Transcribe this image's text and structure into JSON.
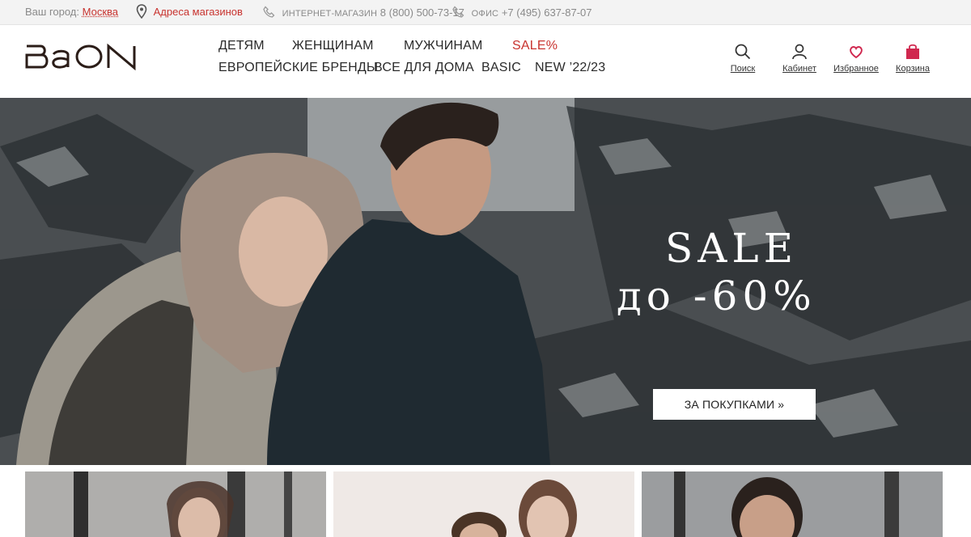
{
  "topbar": {
    "city_label": "Ваш город:",
    "city_value": "Москва",
    "stores_link": "Адреса магазинов",
    "online_label": "ИНТЕРНЕТ-МАГАЗИН",
    "online_phone": "8 (800) 500-73-17",
    "office_label": "ОФИС",
    "office_phone": "+7 (495) 637-87-07"
  },
  "header": {
    "logo_text": "BAON",
    "nav": {
      "kids": "ДЕТЯМ",
      "women": "ЖЕНЩИНАМ",
      "men": "МУЖЧИНАМ",
      "sale": "SALE%",
      "european": "ЕВРОПЕЙСКИЕ БРЕНДЫ",
      "home": "ВСЕ ДЛЯ ДОМА",
      "basic": "BASIC",
      "new": "NEW ’22/23"
    },
    "icons": {
      "search": "Поиск",
      "account": "Кабинет",
      "favorites": "Избранное",
      "cart": "Корзина"
    }
  },
  "hero": {
    "title": "SALE",
    "subtitle": "до -60%",
    "cta": "ЗА ПОКУПКАМИ »"
  },
  "colors": {
    "accent": "#c8332f",
    "heart": "#d0284f",
    "cart": "#d0284f"
  }
}
